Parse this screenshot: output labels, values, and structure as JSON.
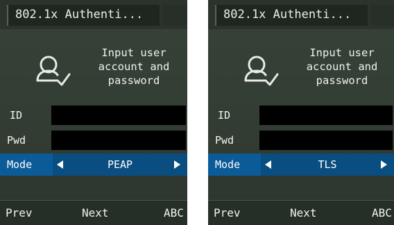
{
  "screens": [
    {
      "title": "802.1x Authenti...",
      "prompt": "Input user\naccount and\npassword",
      "fields": {
        "id_label": "ID",
        "pwd_label": "Pwd",
        "id_value": "",
        "pwd_value": ""
      },
      "mode": {
        "label": "Mode",
        "value": "PEAP"
      },
      "softkeys": {
        "prev": "Prev",
        "next": "Next",
        "abc": "ABC"
      }
    },
    {
      "title": "802.1x Authenti...",
      "prompt": "Input user\naccount and\npassword",
      "fields": {
        "id_label": "ID",
        "pwd_label": "Pwd",
        "id_value": "",
        "pwd_value": ""
      },
      "mode": {
        "label": "Mode",
        "value": "TLS"
      },
      "softkeys": {
        "prev": "Prev",
        "next": "Next",
        "abc": "ABC"
      }
    }
  ],
  "colors": {
    "background": "#333d34",
    "selected_row": "#0b5b98",
    "field": "#000000",
    "text": "#ffffff"
  },
  "icons": {
    "prompt": "user-check-icon",
    "mode_prev": "arrow-left-icon",
    "mode_next": "arrow-right-icon"
  }
}
